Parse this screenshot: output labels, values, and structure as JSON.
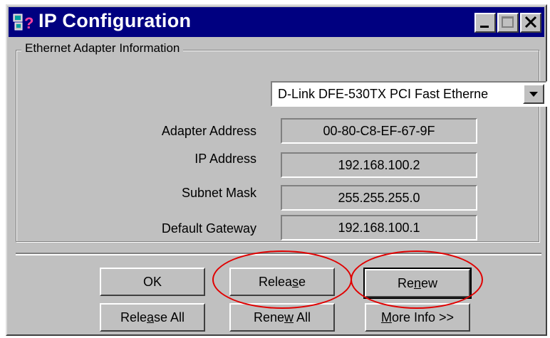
{
  "window": {
    "title": "IP Configuration"
  },
  "group": {
    "label": "Ethernet  Adapter Information"
  },
  "adapter_select": {
    "value": "D-Link DFE-530TX PCI Fast Etherne"
  },
  "fields": [
    {
      "label": "Adapter Address",
      "value": "00-80-C8-EF-67-9F"
    },
    {
      "label": "IP Address",
      "value": "192.168.100.2"
    },
    {
      "label": "Subnet Mask",
      "value": "255.255.255.0"
    },
    {
      "label": "Default Gateway",
      "value": "192.168.100.1"
    }
  ],
  "buttons": {
    "ok": "OK",
    "release": {
      "pre": "Relea",
      "u": "s",
      "post": "e"
    },
    "renew": {
      "pre": "Re",
      "u": "n",
      "post": "ew"
    },
    "release_all": {
      "pre": "Rele",
      "u": "a",
      "post": "se All"
    },
    "renew_all": {
      "pre": "Rene",
      "u": "w",
      "post": " All"
    },
    "more_info": {
      "pre": "",
      "u": "M",
      "post": "ore Info >>"
    }
  },
  "annotation_color": "#e00000",
  "icons": {
    "app": "network-question-icon",
    "minimize": "minimize-icon",
    "maximize": "maximize-icon",
    "close": "close-icon",
    "dropdown": "chevron-down-icon"
  }
}
